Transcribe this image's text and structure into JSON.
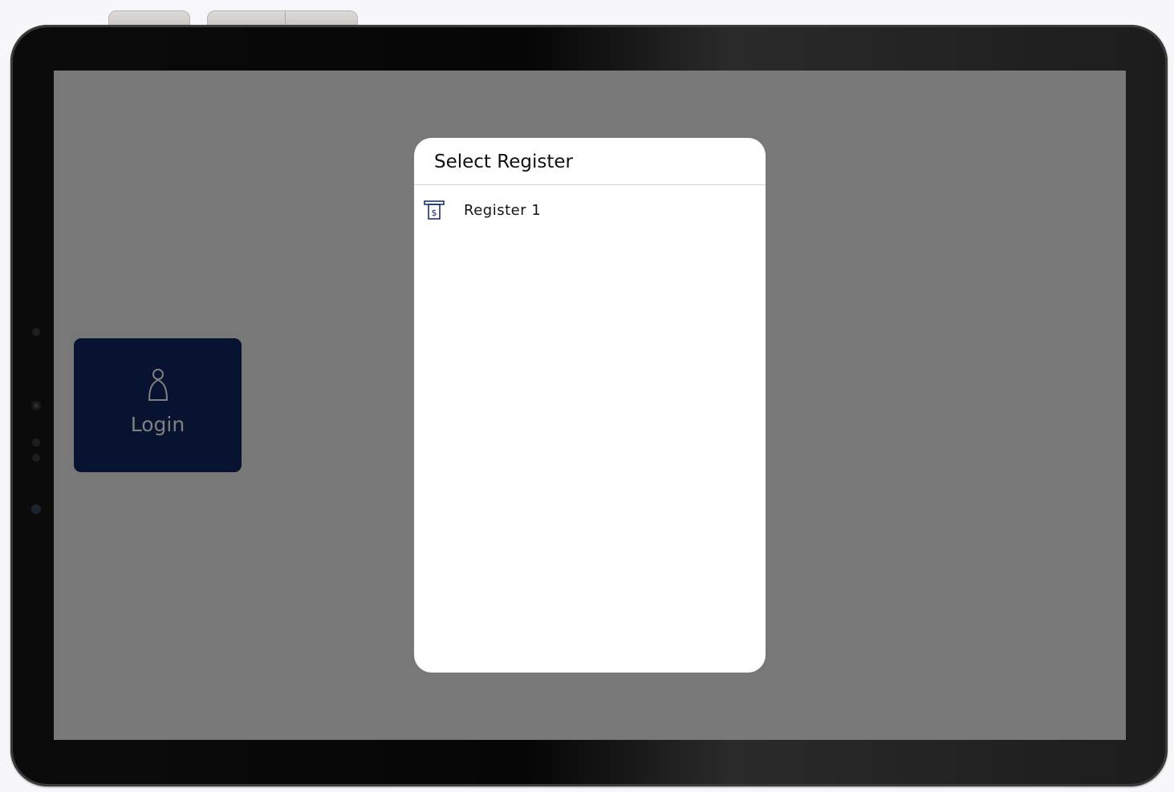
{
  "app": {
    "login_tile": {
      "label": "Login",
      "icon": "user-icon"
    }
  },
  "dialog": {
    "title": "Select Register",
    "registers": [
      {
        "label": "Register 1",
        "icon": "cash-register-icon"
      }
    ]
  },
  "colors": {
    "login_tile_bg": "#0f2660",
    "accent_icon": "#0f2660",
    "scrim": "rgba(0,0,0,0.5)"
  }
}
